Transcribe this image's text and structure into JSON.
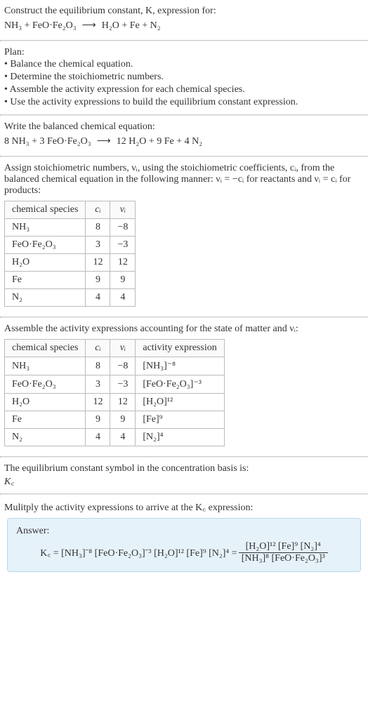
{
  "header": {
    "title": "Construct the equilibrium constant, K, expression for:",
    "equation_lhs": "NH₃ + FeO·Fe₂O₃",
    "equation_arrow": "⟶",
    "equation_rhs": "H₂O + Fe + N₂"
  },
  "plan": {
    "title": "Plan:",
    "items": [
      "• Balance the chemical equation.",
      "• Determine the stoichiometric numbers.",
      "• Assemble the activity expression for each chemical species.",
      "• Use the activity expressions to build the equilibrium constant expression."
    ]
  },
  "balanced": {
    "title": "Write the balanced chemical equation:",
    "lhs": "8 NH₃ + 3 FeO·Fe₂O₃",
    "arrow": "⟶",
    "rhs": "12 H₂O + 9 Fe + 4 N₂"
  },
  "stoich": {
    "intro_a": "Assign stoichiometric numbers, νᵢ, using the stoichiometric coefficients, cᵢ, from the balanced chemical equation in the following manner: νᵢ = −cᵢ for reactants and νᵢ = cᵢ for products:",
    "headers": [
      "chemical species",
      "cᵢ",
      "νᵢ"
    ],
    "rows": [
      [
        "NH₃",
        "8",
        "−8"
      ],
      [
        "FeO·Fe₂O₃",
        "3",
        "−3"
      ],
      [
        "H₂O",
        "12",
        "12"
      ],
      [
        "Fe",
        "9",
        "9"
      ],
      [
        "N₂",
        "4",
        "4"
      ]
    ]
  },
  "activity": {
    "intro": "Assemble the activity expressions accounting for the state of matter and νᵢ:",
    "headers": [
      "chemical species",
      "cᵢ",
      "νᵢ",
      "activity expression"
    ],
    "rows": [
      [
        "NH₃",
        "8",
        "−8",
        "[NH₃]⁻⁸"
      ],
      [
        "FeO·Fe₂O₃",
        "3",
        "−3",
        "[FeO·Fe₂O₃]⁻³"
      ],
      [
        "H₂O",
        "12",
        "12",
        "[H₂O]¹²"
      ],
      [
        "Fe",
        "9",
        "9",
        "[Fe]⁹"
      ],
      [
        "N₂",
        "4",
        "4",
        "[N₂]⁴"
      ]
    ]
  },
  "symbol": {
    "line1": "The equilibrium constant symbol in the concentration basis is:",
    "line2": "K꜀"
  },
  "final": {
    "intro": "Mulitply the activity expressions to arrive at the K꜀ expression:",
    "answer_label": "Answer:",
    "kc_eq_left": "K꜀ = [NH₃]⁻⁸ [FeO·Fe₂O₃]⁻³ [H₂O]¹² [Fe]⁹ [N₂]⁴ =",
    "frac_num": "[H₂O]¹² [Fe]⁹ [N₂]⁴",
    "frac_den": "[NH₃]⁸ [FeO·Fe₂O₃]³"
  }
}
